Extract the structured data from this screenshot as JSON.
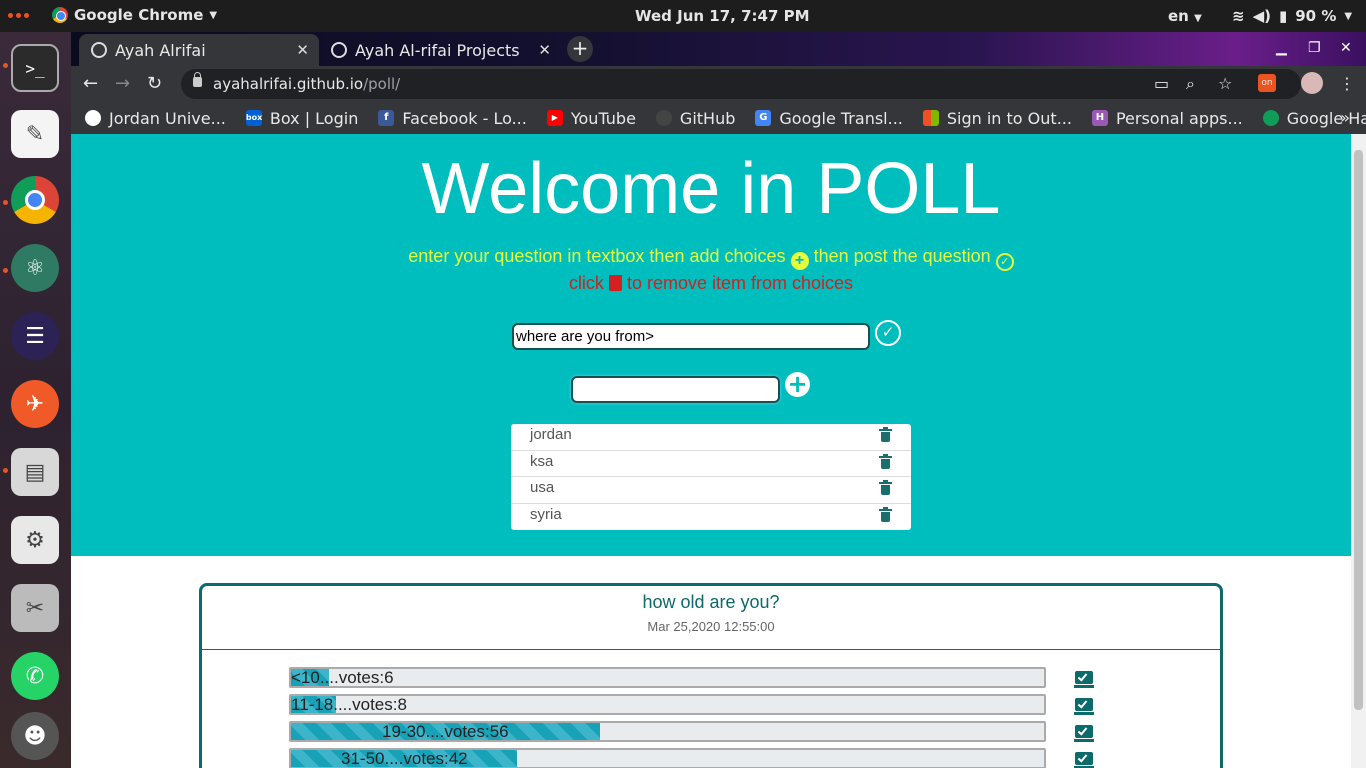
{
  "system": {
    "app_name": "Google Chrome",
    "clock": "Wed Jun 17,  7:47 PM",
    "language": "en",
    "battery": "90 %"
  },
  "browser": {
    "tabs": [
      {
        "title": "Ayah Alrifai",
        "active": true
      },
      {
        "title": "Ayah Al-rifai Projects",
        "active": false
      }
    ],
    "url_host": "ayahalrifai.github.io",
    "url_path": "/poll/",
    "bookmarks": [
      {
        "label": "Jordan Unive...",
        "icon": "university-icon",
        "color": "#ffffff"
      },
      {
        "label": "Box | Login",
        "icon": "box-icon",
        "color": "#0061d5"
      },
      {
        "label": "Facebook - Lo...",
        "icon": "facebook-icon",
        "color": "#3b5998"
      },
      {
        "label": "YouTube",
        "icon": "youtube-icon",
        "color": "#ff0000"
      },
      {
        "label": "GitHub",
        "icon": "github-icon",
        "color": "#444444"
      },
      {
        "label": "Google Transl...",
        "icon": "translate-icon",
        "color": "#4285f4"
      },
      {
        "label": "Sign in to Out...",
        "icon": "microsoft-icon",
        "color": "#f25022"
      },
      {
        "label": "Personal apps...",
        "icon": "harvest-icon",
        "color": "#9b59b6"
      },
      {
        "label": "Google Hang...",
        "icon": "hangouts-icon",
        "color": "#0f9d58"
      }
    ]
  },
  "page": {
    "title": "Welcome in POLL",
    "instruction_part1": "enter your question in textbox then add choices",
    "instruction_part2": "then post the question",
    "remove_part1": "click",
    "remove_part2": "to remove item from choices",
    "question_value": "where are you from>",
    "choice_value": "",
    "choices": [
      "jordan",
      "ksa",
      "usa",
      "syria"
    ],
    "colors": {
      "hero": "#00bebe",
      "instruction": "#e6ff3a",
      "remove": "#d42020",
      "accent": "#0d6a6a"
    }
  },
  "poll": {
    "question": "how old are you?",
    "date": "Mar 25,2020 12:55:00",
    "options": [
      {
        "label": "<10....votes:6",
        "votes": 6,
        "percent": 0.05
      },
      {
        "label": "11-18....votes:8",
        "votes": 8,
        "percent": 0.06
      },
      {
        "label": "19-30....votes:56",
        "votes": 56,
        "percent": 0.41
      },
      {
        "label": "31-50....votes:42",
        "votes": 42,
        "percent": 0.3
      }
    ]
  }
}
